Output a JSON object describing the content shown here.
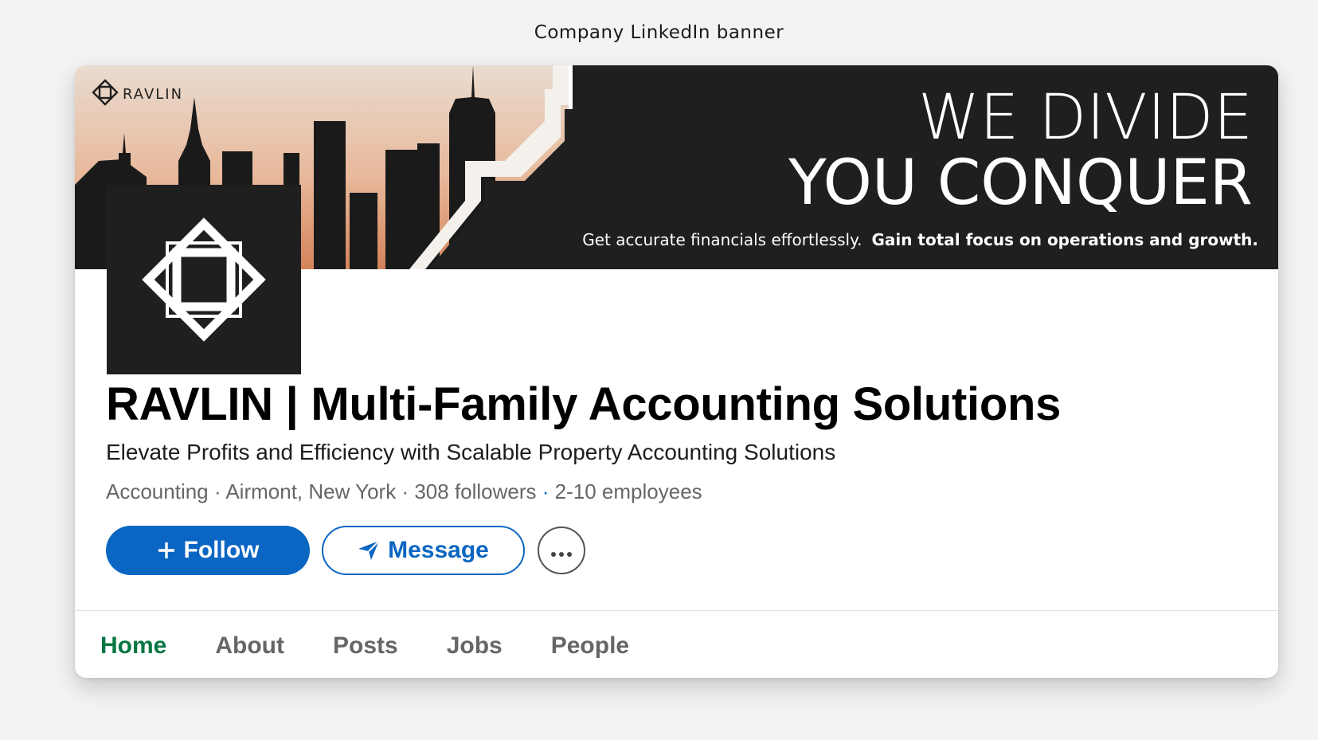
{
  "caption": "Company LinkedIn banner",
  "banner": {
    "brand": "RAVLIN",
    "headline_line1": "WE DIVIDE",
    "headline_line2": "YOU CONQUER",
    "sub_left": "Get accurate financials effortlessly.",
    "sub_right": "Gain total focus on operations and growth."
  },
  "company": {
    "name": "RAVLIN | Multi-Family Accounting Solutions",
    "tagline": "Elevate Profits and Efficiency with Scalable Property Accounting Solutions",
    "industry": "Accounting",
    "location": "Airmont, New York",
    "followers": "308 followers",
    "employees": "2-10 employees"
  },
  "actions": {
    "follow_label": "Follow",
    "message_label": "Message"
  },
  "tabs": [
    {
      "label": "Home",
      "active": true
    },
    {
      "label": "About",
      "active": false
    },
    {
      "label": "Posts",
      "active": false
    },
    {
      "label": "Jobs",
      "active": false
    },
    {
      "label": "People",
      "active": false
    }
  ],
  "colors": {
    "primary": "#0a66c2",
    "active_tab": "#057642",
    "banner_dark": "#1f1f1f"
  },
  "icons": [
    "ravlin-logo-icon",
    "plus-icon",
    "send-icon",
    "more-icon"
  ]
}
